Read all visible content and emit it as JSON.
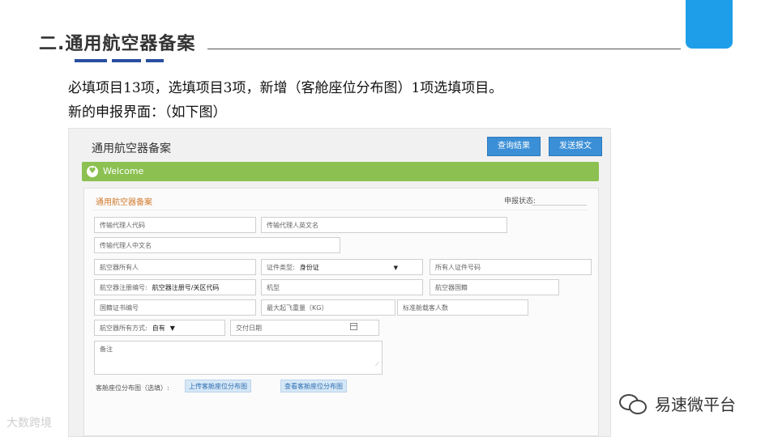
{
  "slide": {
    "title": "二.通用航空器备案",
    "line1": "必填项目13项，选填项目3项，新增（客舱座位分布图）1项选填项目。",
    "line2": "新的申报界面：（如下图）"
  },
  "app": {
    "title": "通用航空器备案",
    "query_btn": "查询结果",
    "send_btn": "发送报文",
    "welcome": "Welcome",
    "form_title": "通用航空器备案",
    "status_label": "申报状态:"
  },
  "fields": {
    "agent_code": "传输代理人代码",
    "agent_en": "传输代理人英文名",
    "agent_cn": "传输代理人中文名",
    "owner": "航空器所有人",
    "cert_type_label": "证件类型:",
    "cert_type_value": "身份证",
    "owner_cert_no": "所有人证件号码",
    "reg_no_label": "航空器注册编号:",
    "reg_no_value": "航空器注册号/关区代码",
    "model": "机型",
    "nationality": "航空器国籍",
    "nationality_cert": "国籍证书编号",
    "mtow": "最大起飞重量（KG）",
    "std_seats": "标准舱载客人数",
    "ownership_label": "航空器所有方式:",
    "ownership_value": "自有",
    "delivery_date": "交付日期",
    "remarks": "备注"
  },
  "upload": {
    "label": "客舱座位分布图（选填）:",
    "upload_btn": "上传客舱座位分布图",
    "view_btn": "查看客舱座位分布图"
  },
  "watermarks": {
    "left": "大数跨境",
    "right": "易速微平台"
  }
}
